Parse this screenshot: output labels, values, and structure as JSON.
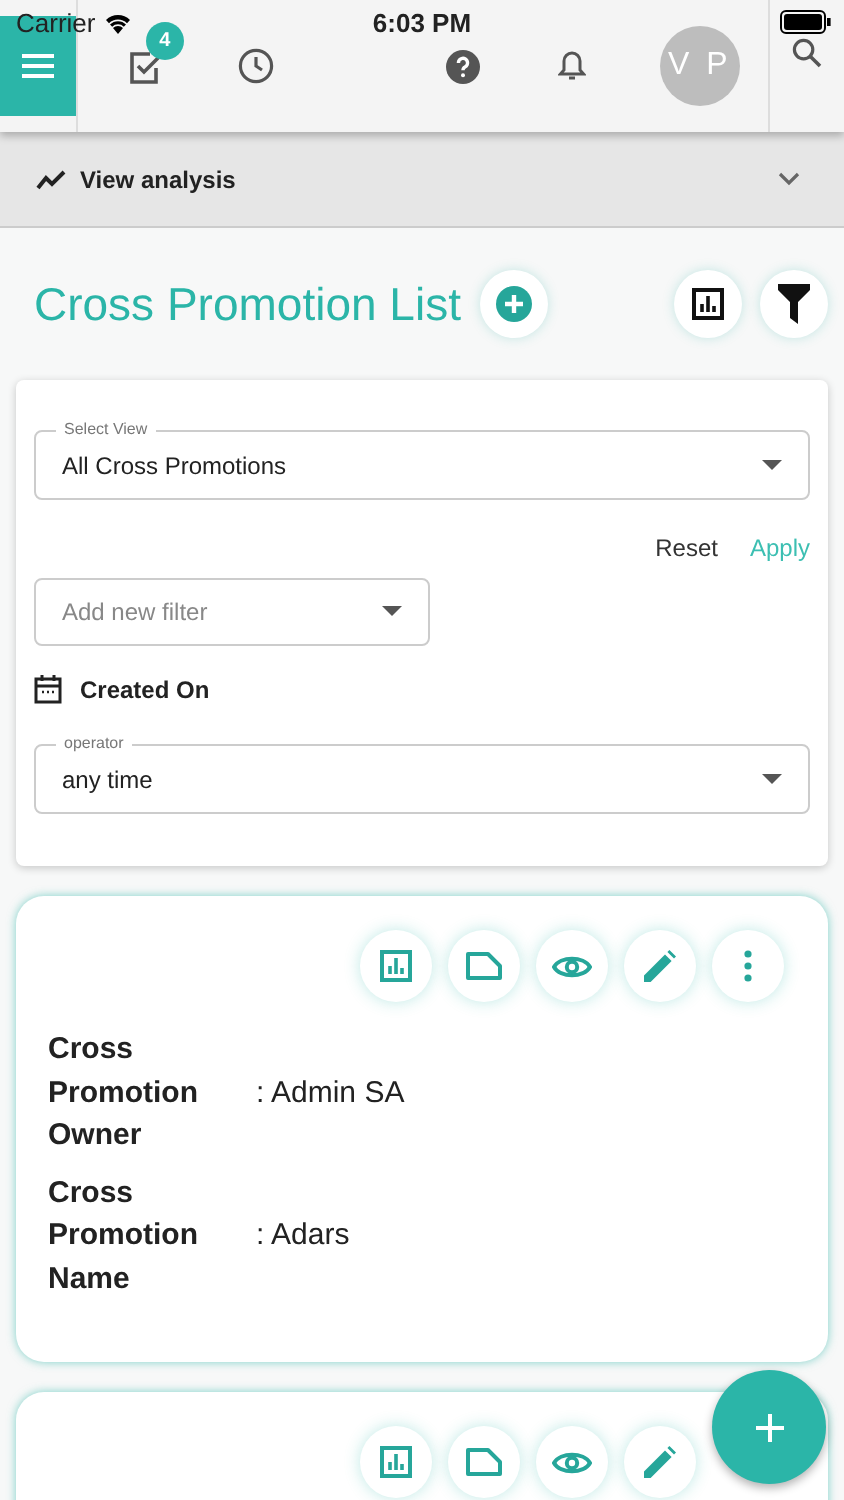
{
  "status_bar": {
    "carrier": "Carrier",
    "time": "6:03 PM"
  },
  "toolbar": {
    "tasks_badge": "4",
    "avatar": "V P"
  },
  "analysis_bar": {
    "label": "View analysis",
    "expanded": false
  },
  "page_title": "Cross Promotion List",
  "filter_panel": {
    "select_view": {
      "label": "Select View",
      "value": "All Cross Promotions"
    },
    "reset": "Reset",
    "apply": "Apply",
    "add_filter": {
      "placeholder": "Add new filter"
    },
    "date_filter": "Created On",
    "operator": {
      "label": "operator",
      "value": "any time"
    }
  },
  "records": [
    {
      "actions": [
        {
          "kind": "chart"
        },
        {
          "kind": "tag"
        },
        {
          "kind": "view"
        },
        {
          "kind": "edit"
        },
        {
          "kind": "more"
        }
      ],
      "fields": [
        {
          "label": "Cross Promotion Owner",
          "value": ": Admin SA"
        },
        {
          "label": "Cross Promotion Name",
          "value": ": Adars"
        }
      ]
    },
    {
      "actions": [
        {
          "kind": "chart"
        },
        {
          "kind": "tag"
        },
        {
          "kind": "view"
        },
        {
          "kind": "edit"
        }
      ]
    }
  ]
}
